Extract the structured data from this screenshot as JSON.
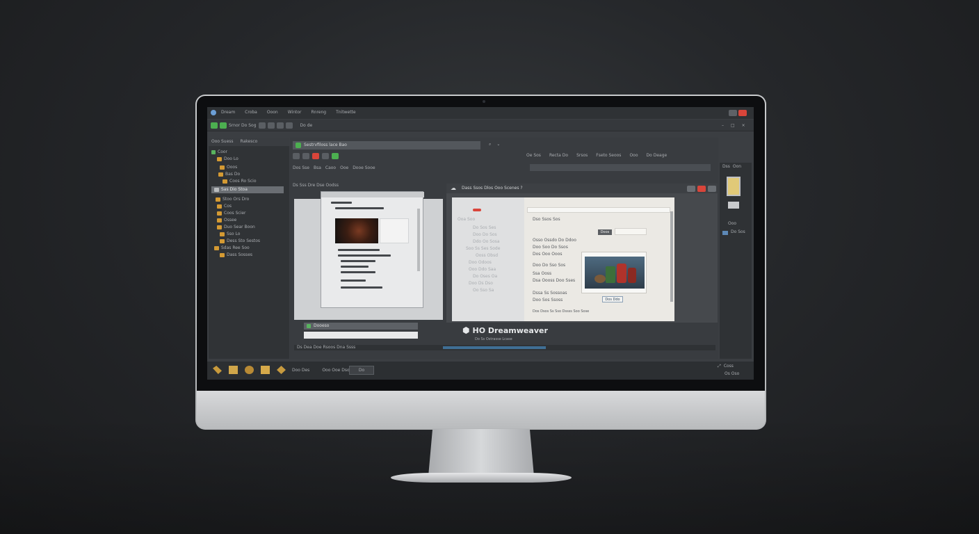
{
  "app": {
    "name": "HO Dreamweaver",
    "tagline": "Do Ss Ostrasse Lcase"
  },
  "menu": {
    "items": [
      "Dream",
      "Croba",
      "Ooon",
      "Wintor",
      "Rnreng",
      "Tnitwette"
    ]
  },
  "toolbar": {
    "doc_label": "Srnor Do Sog",
    "zoom": "Do de"
  },
  "left_panel": {
    "tabs": [
      "Ooo Suess",
      "Rakesco"
    ],
    "tree": [
      "Coor",
      "Doo Lo",
      "Ooos",
      "Bas Do",
      "Coos Ro Scio",
      "Sas Dio Stoa",
      "Stoo Ors Dro",
      "Cos",
      "Coos Scier",
      "Ossee",
      "Duo Sear Boon",
      "Sso Lo",
      "Dess Sto Sestos",
      "Sdas Ree Soo",
      "Dass Sosses"
    ],
    "search": "Ooo"
  },
  "editor": {
    "address": "Sestrvfiloss lace Bao",
    "tabs": [
      "Dos Sse",
      "Bsa",
      "Caoo",
      "Ooe",
      "Dooe Sooe"
    ],
    "doc_tabs": "Ds Sss Dre Dse Oodss",
    "status_field": "Dooeso",
    "status_bar": "Ds Dea Doe Rsoos Dna Ssss"
  },
  "properties": {
    "items": [
      "Oe Sos",
      "Recta Do",
      "Srsos",
      "Fseto Seoos",
      "Ooo",
      "Do Deage"
    ]
  },
  "browser": {
    "title": "Dass Ssos Dlos Ooo Scenes ?",
    "left_lines": [
      "Ooa Soo",
      "Do Sos Ses",
      "Doo Do Sos",
      "Ddo Oo Sosa",
      "Soo Ss Ses Sode",
      "Ooss Obsd",
      "Doo Odoos",
      "Ooo Ddo Saa",
      "Do Oses Oa",
      "Doo Ds Dso",
      "Oo Sso Sa"
    ],
    "right_heading": "Dso Ssos Sos",
    "right_lines": [
      "Osso Ossdo Do Ddoo",
      "Doo Soo Do Ssos",
      "Dos Ooo Ooos",
      "Doo Do Sso Sos",
      "Ssa Ooss",
      "Dsa Oooss Doo Sses",
      "Dssa Ss Sossoas",
      "Doo Sos Ssoss"
    ],
    "search_btn": "Doos",
    "product_btn": "Dos Ddo",
    "footer": "Dos Dsos Ss Sso Dssss Soo Sose"
  },
  "side": {
    "labels": [
      "Dss",
      "Oon"
    ],
    "bottom_labels": [
      "Ooo",
      "Do Sos"
    ]
  },
  "bottom": {
    "labels": [
      "Doo Des",
      "Ooo Ooe Dso",
      "Do"
    ],
    "right_labels": [
      "Coss",
      "Os Oso"
    ]
  },
  "colors": {
    "accent_green": "#4caf50",
    "folder": "#d49a33",
    "close_red": "#d9453a",
    "progress_blue": "#3f6f95"
  }
}
